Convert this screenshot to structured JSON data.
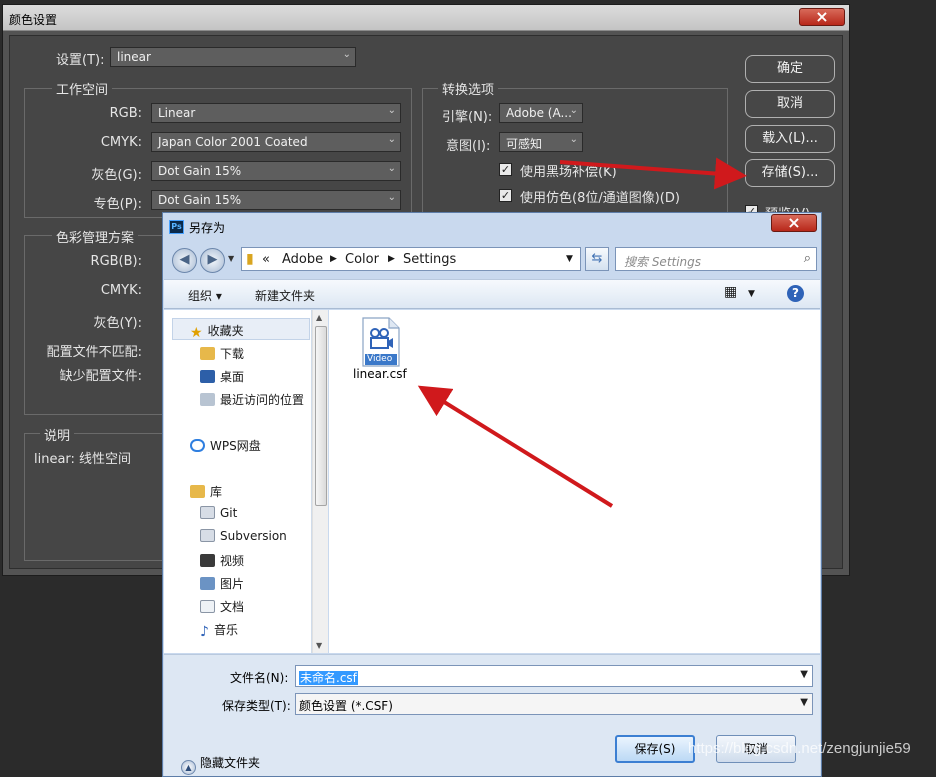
{
  "ps_dialog": {
    "title": "颜色设置",
    "settings_label": "设置(T):",
    "settings_value": "linear",
    "working_spaces": {
      "title": "工作空间",
      "rgb_label": "RGB:",
      "rgb_value": "Linear",
      "cmyk_label": "CMYK:",
      "cmyk_value": "Japan Color 2001 Coated",
      "gray_label": "灰色(G):",
      "gray_value": "Dot Gain 15%",
      "spot_label": "专色(P):",
      "spot_value": "Dot Gain 15%"
    },
    "color_management": {
      "title": "色彩管理方案",
      "rgb_label": "RGB(B):",
      "cmyk_label": "CMYK:",
      "gray_label": "灰色(Y):",
      "mismatch_label": "配置文件不匹配:",
      "missing_label": "缺少配置文件:"
    },
    "conversion": {
      "title": "转换选项",
      "engine_label": "引擎(N):",
      "engine_value": "Adobe (A...",
      "intent_label": "意图(I):",
      "intent_value": "可感知",
      "bpc_label": "使用黑场补偿(K)",
      "dither_label": "使用仿色(8位/通道图像)(D)"
    },
    "description": {
      "title": "说明",
      "text": "linear:  线性空间"
    },
    "buttons": {
      "ok": "确定",
      "cancel": "取消",
      "load": "载入(L)...",
      "save": "存储(S)...",
      "preview": "预览(V)"
    }
  },
  "save_as": {
    "title": "另存为",
    "breadcrumb": [
      "«",
      "Adobe",
      "Color",
      "Settings"
    ],
    "search_placeholder": "搜索 Settings",
    "toolbar": {
      "organize": "组织",
      "new_folder": "新建文件夹"
    },
    "nav": {
      "favorites": "收藏夹",
      "downloads": "下载",
      "desktop": "桌面",
      "recent": "最近访问的位置",
      "wps": "WPS网盘",
      "libraries": "库",
      "git": "Git",
      "subversion": "Subversion",
      "videos": "视频",
      "pictures": "图片",
      "documents": "文档",
      "music": "音乐"
    },
    "files": [
      {
        "name": "linear.csf",
        "icon_label": "Video"
      }
    ],
    "filename_label": "文件名(N):",
    "filename_value": "未命名.csf",
    "filetype_label": "保存类型(T):",
    "filetype_value": "颜色设置 (*.CSF)",
    "hide_folders": "隐藏文件夹",
    "save_button": "保存(S)",
    "cancel_button": "取消"
  },
  "watermark": "https://blog.csdn.net/zengjunjie59",
  "colors": {
    "annotation_arrow": "#d0191c",
    "ps_bg": "#464646",
    "win_frame": "#c9d9ee"
  }
}
